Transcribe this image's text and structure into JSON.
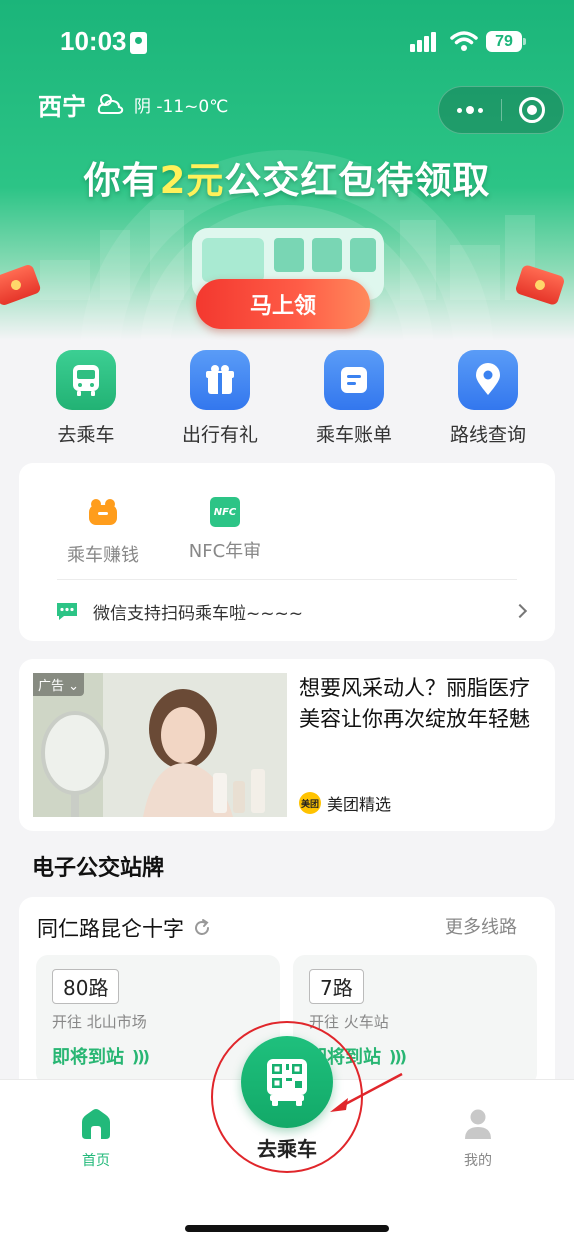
{
  "status_bar": {
    "time": "10:03",
    "battery": "79"
  },
  "header": {
    "city": "西宁",
    "weather": "阴 -11~0℃"
  },
  "banner": {
    "title_prefix": "你有",
    "title_amount": "2元",
    "title_suffix": "公交红包待领取",
    "claim_button": "马上领"
  },
  "quick_actions": [
    {
      "label": "去乘车",
      "icon": "bus-icon",
      "color": "#2fbf82"
    },
    {
      "label": "出行有礼",
      "icon": "gift-icon",
      "color": "#3b82f0"
    },
    {
      "label": "乘车账单",
      "icon": "bill-icon",
      "color": "#3b82f0"
    },
    {
      "label": "路线查询",
      "icon": "location-pin-icon",
      "color": "#3b82f0"
    }
  ],
  "services": [
    {
      "label": "乘车赚钱",
      "icon": "coin-bag-icon"
    },
    {
      "label": "NFC年审",
      "icon": "nfc-icon",
      "icon_text": "NFC"
    }
  ],
  "notice": {
    "text": "微信支持扫码乘车啦~~~~"
  },
  "ad": {
    "tag": "广告",
    "title": "想要风采动人？丽脂医疗美容让你再次绽放年轻魅",
    "brand_logo": "美团",
    "brand": "美团精选"
  },
  "bus_stop": {
    "section_title": "电子公交站牌",
    "stop_name": "同仁路昆仑十字",
    "more_lines": "更多线路",
    "routes": [
      {
        "route": "80路",
        "direction": "开往 北山市场",
        "status": "即将到站"
      },
      {
        "route": "7路",
        "direction": "开往 火车站",
        "status": "即将到站"
      }
    ]
  },
  "bottom_nav": {
    "home": "首页",
    "ride": "去乘车",
    "mine": "我的"
  },
  "colors": {
    "brand_green": "#1bb57a",
    "claim_red": "#f3382f",
    "amount_yellow": "#fff15a",
    "annotation_red": "#e0262b"
  }
}
